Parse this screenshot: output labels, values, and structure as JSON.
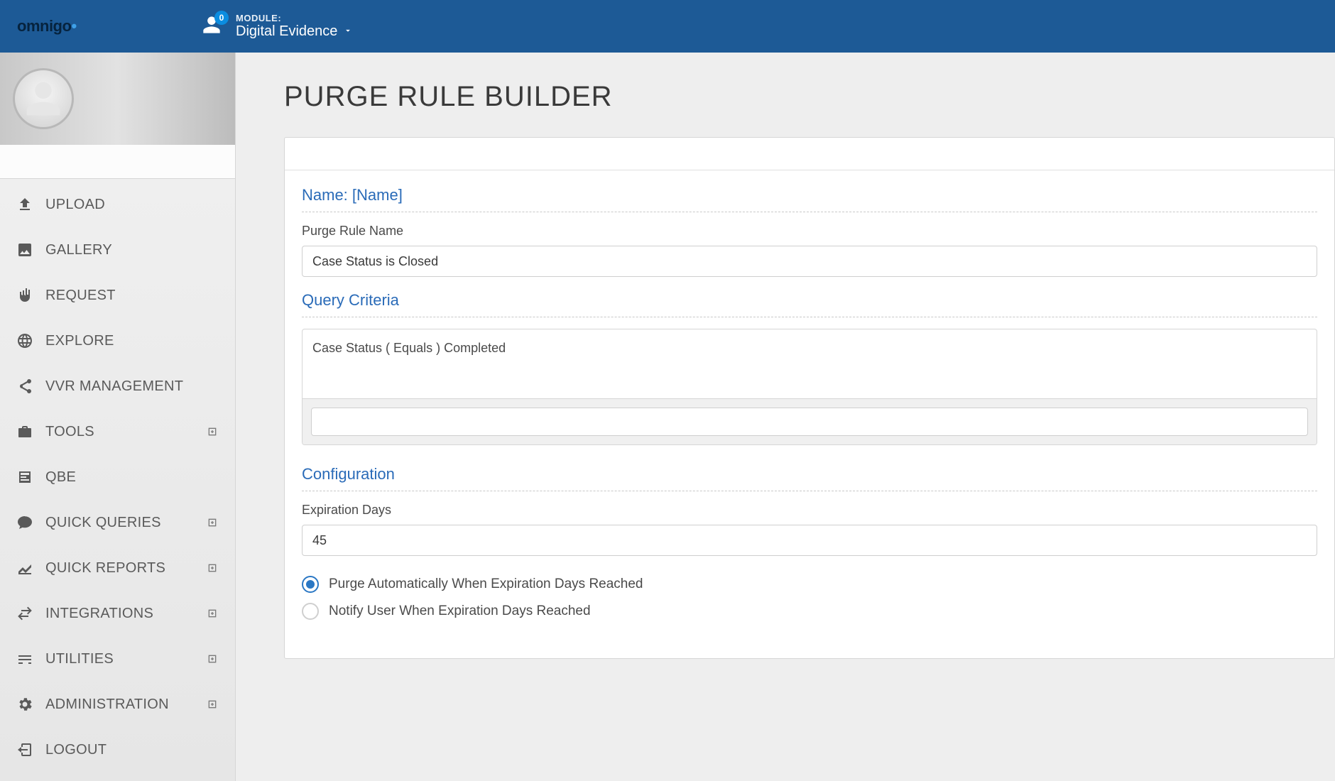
{
  "header": {
    "logo_text": "omnigo",
    "badge_count": "0",
    "module_label": "MODULE:",
    "module_name": "Digital Evidence"
  },
  "sidebar": {
    "items": [
      {
        "label": "UPLOAD",
        "icon": "upload",
        "expandable": false
      },
      {
        "label": "GALLERY",
        "icon": "gallery",
        "expandable": false
      },
      {
        "label": "REQUEST",
        "icon": "hand",
        "expandable": false
      },
      {
        "label": "EXPLORE",
        "icon": "globe",
        "expandable": false
      },
      {
        "label": "VVR MANAGEMENT",
        "icon": "share",
        "expandable": false
      },
      {
        "label": "TOOLS",
        "icon": "briefcase",
        "expandable": true
      },
      {
        "label": "QBE",
        "icon": "form",
        "expandable": false
      },
      {
        "label": "QUICK QUERIES",
        "icon": "chat",
        "expandable": true
      },
      {
        "label": "QUICK REPORTS",
        "icon": "chart",
        "expandable": true
      },
      {
        "label": "INTEGRATIONS",
        "icon": "transfer",
        "expandable": true
      },
      {
        "label": "UTILITIES",
        "icon": "sliders",
        "expandable": true
      },
      {
        "label": "ADMINISTRATION",
        "icon": "gear",
        "expandable": true
      },
      {
        "label": "LOGOUT",
        "icon": "logout",
        "expandable": false
      }
    ]
  },
  "page": {
    "title": "PURGE RULE BUILDER",
    "name_section_title": "Name: [Name]",
    "rule_name_label": "Purge Rule Name",
    "rule_name_value": "Case Status is Closed",
    "query_section_title": "Query Criteria",
    "query_text": "Case Status ( Equals ) Completed",
    "query_subinput_value": "",
    "config_section_title": "Configuration",
    "expiration_label": "Expiration Days",
    "expiration_value": "45",
    "radio_options": [
      {
        "label": "Purge Automatically When Expiration Days Reached",
        "selected": true
      },
      {
        "label": "Notify User When Expiration Days Reached",
        "selected": false
      }
    ]
  }
}
